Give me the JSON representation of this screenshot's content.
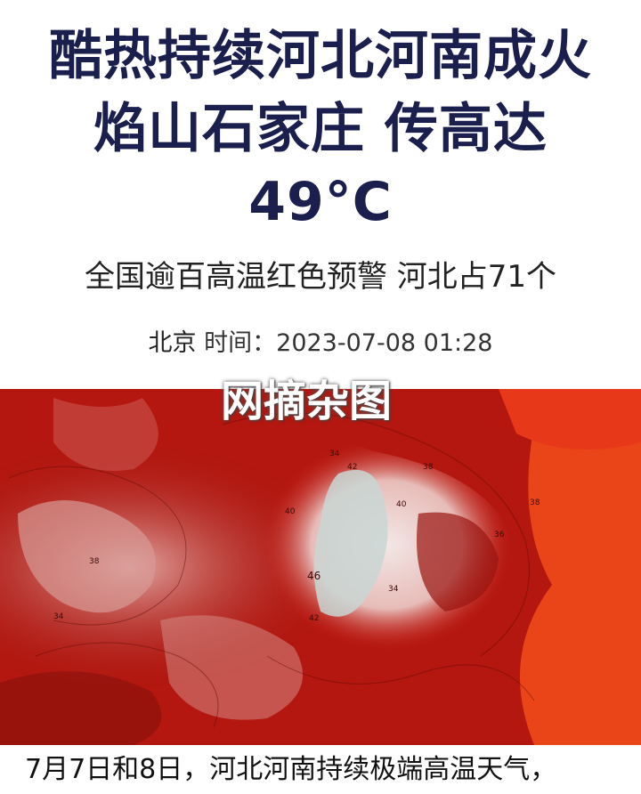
{
  "article": {
    "headline_line1": "酷热持续河北河南成火",
    "headline_line2": "焰山石家庄 传高达",
    "headline_line3": "49°C",
    "subheading": "全国逾百高温红色预警 河北占71个",
    "source": "北京",
    "time_label": "时间：",
    "timestamp": "2023-07-08 01:28",
    "watermark": "网摘杂图",
    "caption": "7月7日和8日，河北河南持续极端高温天气，"
  },
  "map": {
    "contour_labels": [
      "34",
      "38",
      "40",
      "42",
      "46",
      "42",
      "34",
      "38",
      "36",
      "34",
      "38",
      "40"
    ],
    "colors": {
      "dark_red": "#a3140f",
      "red": "#c81e16",
      "light": "#e9c6c4",
      "pale": "#f3e7e6",
      "cold_core": "#c9d6d3",
      "orange": "#ee4b1c"
    }
  }
}
